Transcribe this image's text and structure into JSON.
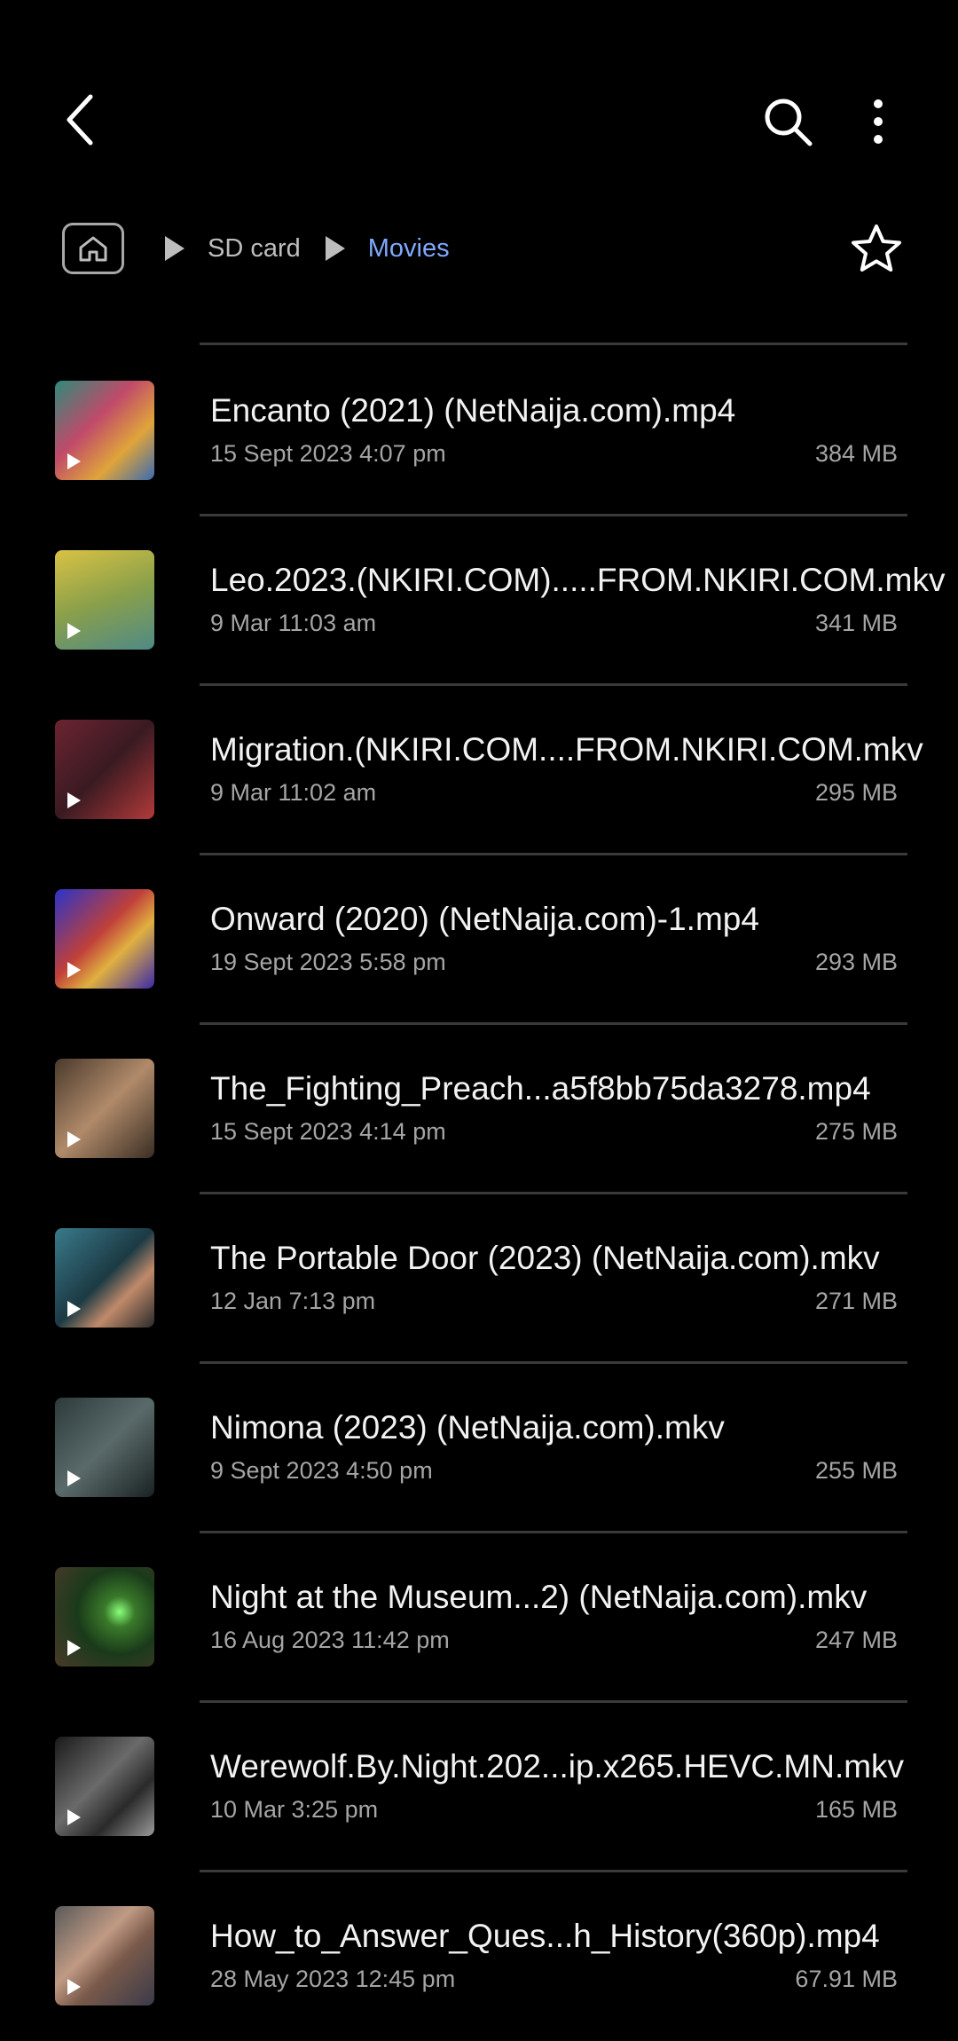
{
  "toolbar": {
    "back_icon": "back-arrow-icon",
    "search_icon": "search-icon",
    "more_icon": "more-vertical-icon"
  },
  "breadcrumb": {
    "home_icon": "home-icon",
    "items": [
      "SD card",
      "Movies"
    ],
    "current_color": "#7fa8ff"
  },
  "favorite_icon": "star-icon",
  "files": [
    {
      "name": "Encanto (2021) (NetNaija.com).mp4",
      "date": "15 Sept 2023 4:07 pm",
      "size": "384 MB"
    },
    {
      "name": "Leo.2023.(NKIRI.COM).....FROM.NKIRI.COM.mkv",
      "date": "9 Mar 11:03 am",
      "size": "341 MB"
    },
    {
      "name": "Migration.(NKIRI.COM....FROM.NKIRI.COM.mkv",
      "date": "9 Mar 11:02 am",
      "size": "295 MB"
    },
    {
      "name": "Onward (2020) (NetNaija.com)-1.mp4",
      "date": "19 Sept 2023 5:58 pm",
      "size": "293 MB"
    },
    {
      "name": "The_Fighting_Preach...a5f8bb75da3278.mp4",
      "date": "15 Sept 2023 4:14 pm",
      "size": "275 MB"
    },
    {
      "name": "The Portable Door (2023) (NetNaija.com).mkv",
      "date": "12 Jan 7:13 pm",
      "size": "271 MB"
    },
    {
      "name": "Nimona (2023) (NetNaija.com).mkv",
      "date": "9 Sept 2023 4:50 pm",
      "size": "255 MB"
    },
    {
      "name": "Night at the Museum...2) (NetNaija.com).mkv",
      "date": "16 Aug 2023 11:42 pm",
      "size": "247 MB"
    },
    {
      "name": "Werewolf.By.Night.202...ip.x265.HEVC.MN.mkv",
      "date": "10 Mar 3:25 pm",
      "size": "165 MB"
    },
    {
      "name": "How_to_Answer_Ques...h_History(360p).mp4",
      "date": "28 May 2023 12:45 pm",
      "size": "67.91 MB"
    }
  ]
}
